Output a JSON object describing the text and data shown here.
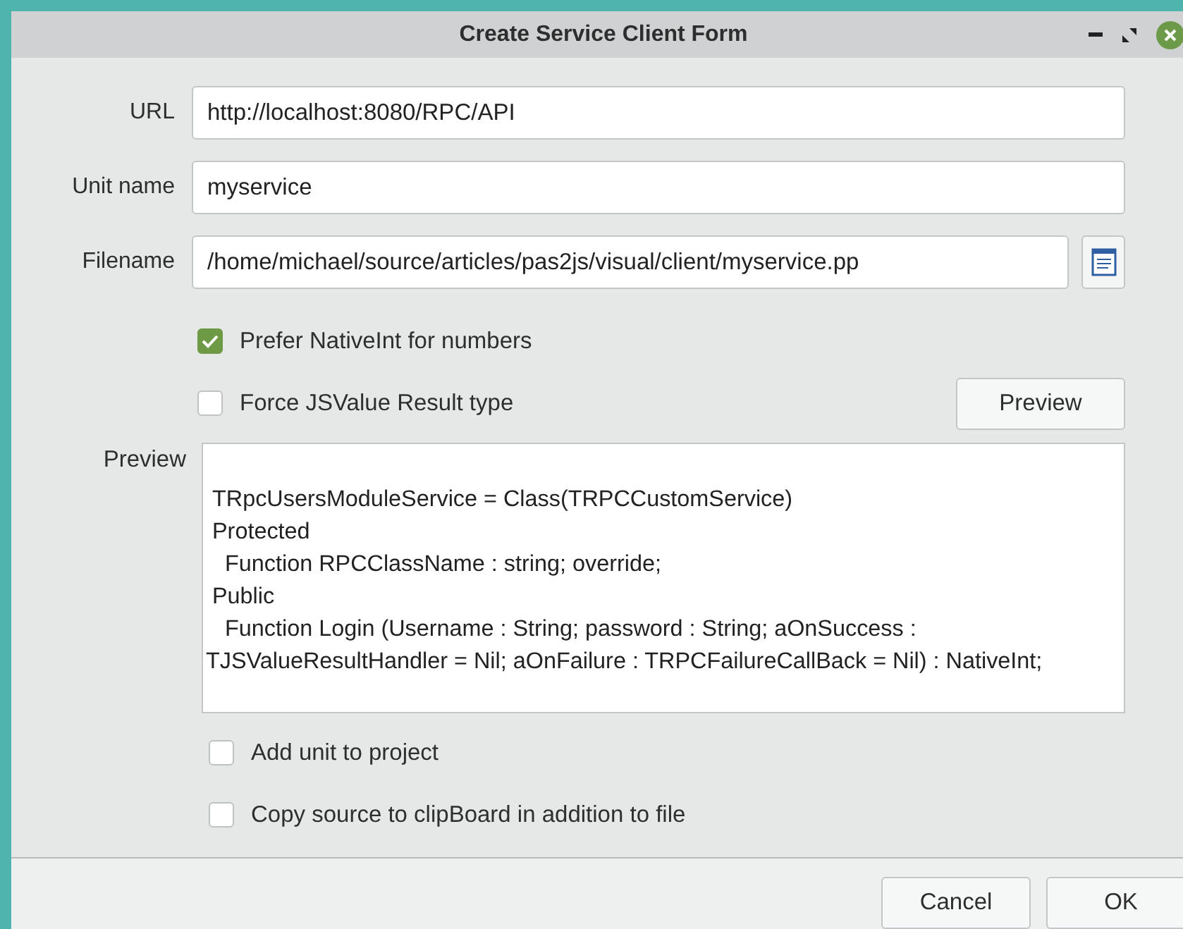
{
  "window": {
    "title": "Create Service Client Form"
  },
  "fields": [
    {
      "label": "URL",
      "value": "http://localhost:8080/RPC/API"
    },
    {
      "label": "Unit name",
      "value": "myservice"
    },
    {
      "label": "Filename",
      "value": "/home/michael/source/articles/pas2js/visual/client/myservice.pp"
    }
  ],
  "options": [
    {
      "label": "Prefer NativeInt for numbers",
      "checked": true
    },
    {
      "label": "Force JSValue Result type",
      "checked": false
    }
  ],
  "preview_button": "Preview",
  "preview": {
    "label": "Preview",
    "lines": [
      " TRpcUsersModuleService = Class(TRPCCustomService)",
      " Protected",
      "   Function RPCClassName : string; override;",
      " Public",
      "   Function Login (Username : String; password : String; aOnSuccess : TJSValueResultHandler = Nil; aOnFailure : TRPCFailureCallBack = Nil) : NativeInt;"
    ]
  },
  "extra_options": [
    {
      "label": "Add unit to project",
      "checked": false
    },
    {
      "label": "Copy source to clipBoard in addition to file",
      "checked": false
    }
  ],
  "buttons": [
    "Cancel",
    "OK"
  ]
}
